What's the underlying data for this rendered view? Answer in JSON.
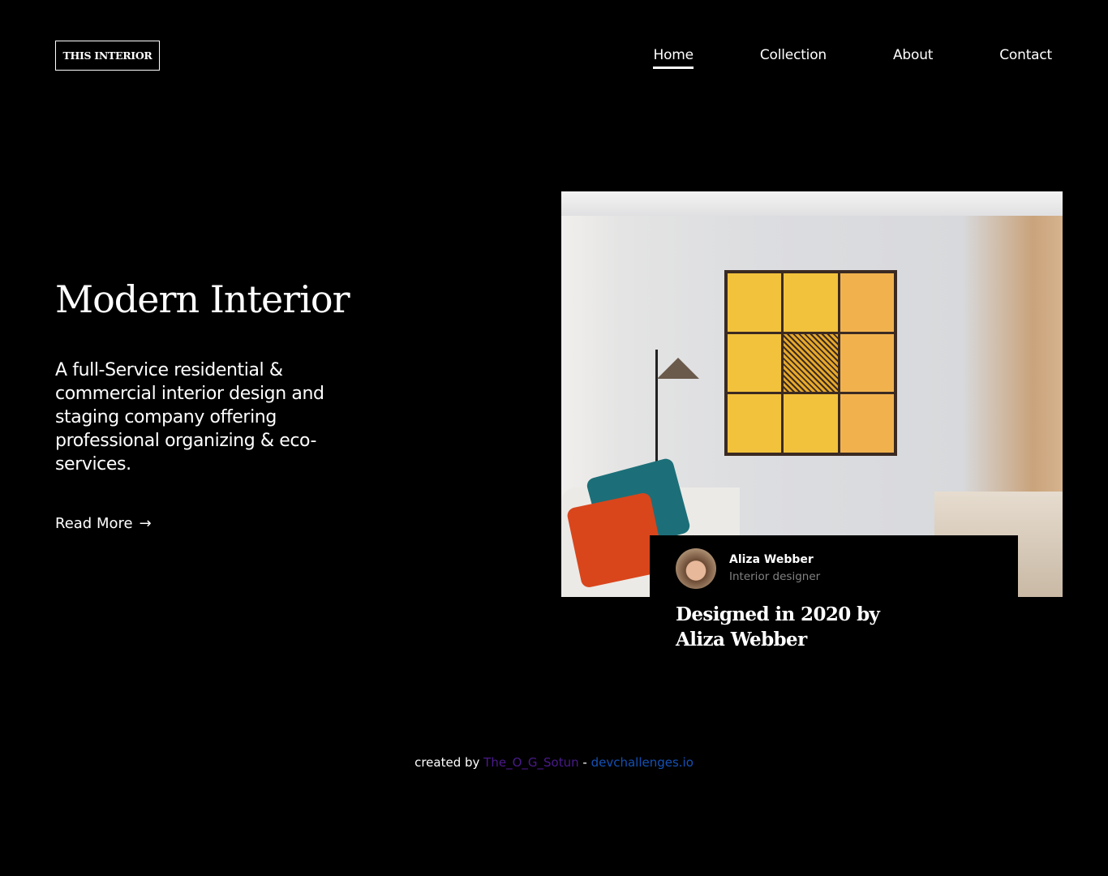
{
  "logo": "THIS INTERIOR",
  "nav": [
    {
      "label": "Home",
      "active": true
    },
    {
      "label": "Collection"
    },
    {
      "label": "About"
    },
    {
      "label": "Contact"
    }
  ],
  "hero": {
    "title": "Modern Interior",
    "description": "A full-Service residential & commercial interior design and staging company offering professional organizing & eco-services.",
    "read_more": "Read More",
    "arrow": "→"
  },
  "card": {
    "name": "Aliza Webber",
    "role": "Interior designer",
    "caption": "Designed in 2020 by Aliza Webber"
  },
  "footer": {
    "prefix": "created by",
    "author": "The_O_G_Sotun",
    "separator": "-",
    "site": "devchallenges.io",
    "author_color": "#4a1a8c",
    "site_color": "#1451b5"
  }
}
